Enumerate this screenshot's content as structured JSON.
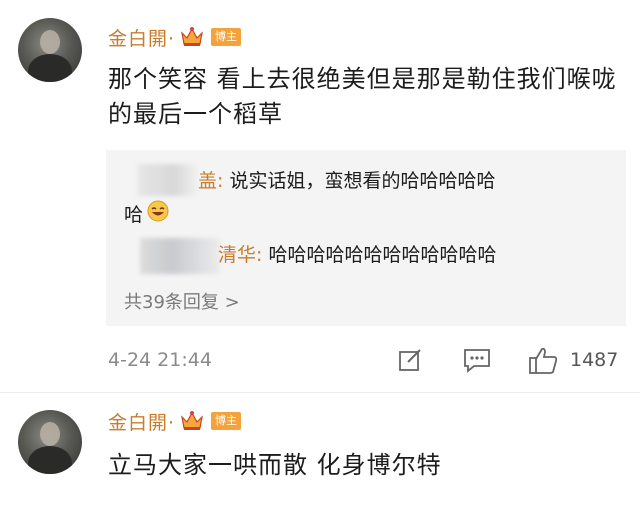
{
  "comments": [
    {
      "username": "金白開·",
      "badge": "博主",
      "text": "那个笑容 看上去很绝美但是那是勒住我们喉咙的最后一个稻草",
      "replies": [
        {
          "name_suffix": "盖:",
          "text": "说实话姐，蛮想看的哈哈哈哈哈",
          "text_cont": "哈"
        },
        {
          "name_suffix": "清华:",
          "text": "哈哈哈哈哈哈哈哈哈哈哈哈"
        }
      ],
      "more_replies": "共39条回复 >",
      "timestamp": "4-24 21:44",
      "likes": "1487"
    },
    {
      "username": "金白開·",
      "badge": "博主",
      "text": "立马大家一哄而散 化身博尔特"
    }
  ],
  "colors": {
    "username": "#c77d2c",
    "badge": "#f4a23a",
    "reply_bg": "#f4f4f4"
  },
  "icons": [
    "crown-icon",
    "laughing-emoji-icon",
    "edit-icon",
    "comment-icon",
    "thumbs-up-icon"
  ]
}
